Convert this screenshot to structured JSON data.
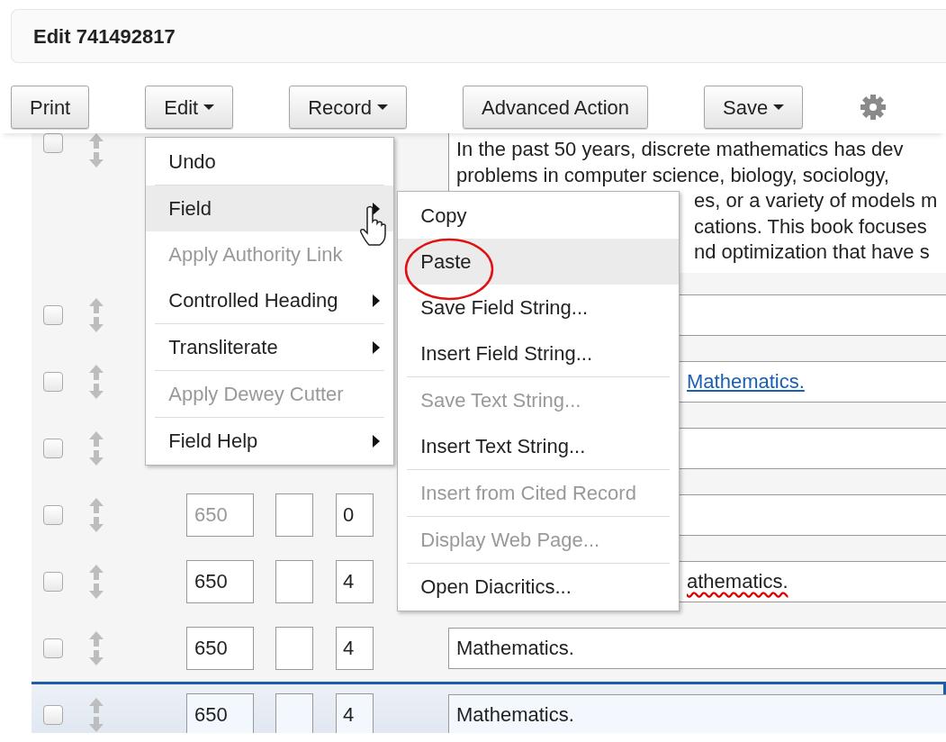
{
  "header": {
    "title": "Edit 741492817"
  },
  "toolbar": [
    {
      "kind": "button",
      "label": "Print"
    },
    {
      "kind": "dropdown",
      "label": "Edit",
      "menu": {
        "items": [
          {
            "kind": "item",
            "label": "Undo",
            "disabled": false,
            "highlighted": false,
            "has_submenu": false
          },
          {
            "kind": "divider"
          },
          {
            "kind": "item",
            "label": "Field",
            "disabled": false,
            "highlighted": true,
            "has_submenu": true,
            "submenu": {
              "items": [
                {
                  "kind": "item",
                  "label": "Copy",
                  "disabled": false,
                  "highlighted": false
                },
                {
                  "kind": "item",
                  "label": "Paste",
                  "disabled": false,
                  "highlighted": true,
                  "circled": true
                },
                {
                  "kind": "item",
                  "label": "Save Field String...",
                  "disabled": false,
                  "highlighted": false
                },
                {
                  "kind": "item",
                  "label": "Insert Field String...",
                  "disabled": false,
                  "highlighted": false
                },
                {
                  "kind": "divider"
                },
                {
                  "kind": "item",
                  "label": "Save Text String...",
                  "disabled": true,
                  "highlighted": false
                },
                {
                  "kind": "item",
                  "label": "Insert Text String...",
                  "disabled": false,
                  "highlighted": false
                },
                {
                  "kind": "divider"
                },
                {
                  "kind": "item",
                  "label": "Insert from Cited Record",
                  "disabled": true,
                  "highlighted": false
                },
                {
                  "kind": "divider"
                },
                {
                  "kind": "item",
                  "label": "Display Web Page...",
                  "disabled": true,
                  "highlighted": false
                },
                {
                  "kind": "divider"
                },
                {
                  "kind": "item",
                  "label": "Open Diacritics...",
                  "disabled": false,
                  "highlighted": false
                }
              ]
            }
          },
          {
            "kind": "item",
            "label": "Apply Authority Link",
            "disabled": true,
            "highlighted": false,
            "has_submenu": false
          },
          {
            "kind": "item",
            "label": "Controlled Heading",
            "disabled": false,
            "highlighted": false,
            "has_submenu": true
          },
          {
            "kind": "divider"
          },
          {
            "kind": "item",
            "label": "Transliterate",
            "disabled": false,
            "highlighted": false,
            "has_submenu": true
          },
          {
            "kind": "divider"
          },
          {
            "kind": "item",
            "label": "Apply Dewey Cutter",
            "disabled": true,
            "highlighted": false,
            "has_submenu": false
          },
          {
            "kind": "divider"
          },
          {
            "kind": "item",
            "label": "Field Help",
            "disabled": false,
            "highlighted": false,
            "has_submenu": true
          }
        ]
      }
    },
    {
      "kind": "dropdown",
      "label": "Record"
    },
    {
      "kind": "button",
      "label": "Advanced Action"
    },
    {
      "kind": "dropdown",
      "label": "Save"
    },
    {
      "kind": "settings"
    }
  ],
  "rows": [
    {
      "checked": false,
      "selected": false,
      "field": {
        "kind": "textarea",
        "lines": [
          {
            "text": "In the past 50 years, discrete mathematics has dev",
            "covered": false
          },
          {
            "text": "problems in computer science, biology, sociology,",
            "covered": false
          },
          {
            "text": "es, or a variety of models m",
            "covered": true
          },
          {
            "text": "cations. This book focuses",
            "covered": true
          },
          {
            "text": "nd optimization that have s",
            "covered": true
          }
        ]
      }
    },
    {
      "checked": false,
      "selected": false,
      "field": {
        "kind": "input"
      }
    },
    {
      "checked": false,
      "selected": false,
      "field": {
        "kind": "input",
        "value": "Mathematics.",
        "covered": true,
        "link": true,
        "misspelled": false
      }
    },
    {
      "checked": false,
      "selected": false,
      "field": {
        "kind": "input"
      }
    },
    {
      "checked": false,
      "selected": false,
      "tag": {
        "value": "650",
        "disabled": true
      },
      "ind2": "0",
      "field": {
        "kind": "input"
      }
    },
    {
      "checked": false,
      "selected": false,
      "tag": {
        "value": "650",
        "disabled": false
      },
      "ind2": "4",
      "field": {
        "kind": "input",
        "value": "athematics.",
        "covered": true,
        "link": false,
        "misspelled": true
      }
    },
    {
      "checked": false,
      "selected": false,
      "tag": {
        "value": "650",
        "disabled": false
      },
      "ind2": "4",
      "field": {
        "kind": "input",
        "value": "Mathematics.",
        "covered": false,
        "link": false,
        "misspelled": false
      }
    },
    {
      "checked": false,
      "selected": true,
      "tag": {
        "value": "650",
        "disabled": false
      },
      "ind2": "4",
      "field": {
        "kind": "input",
        "value": "Mathematics.",
        "covered": false,
        "link": false,
        "misspelled": false
      }
    }
  ]
}
